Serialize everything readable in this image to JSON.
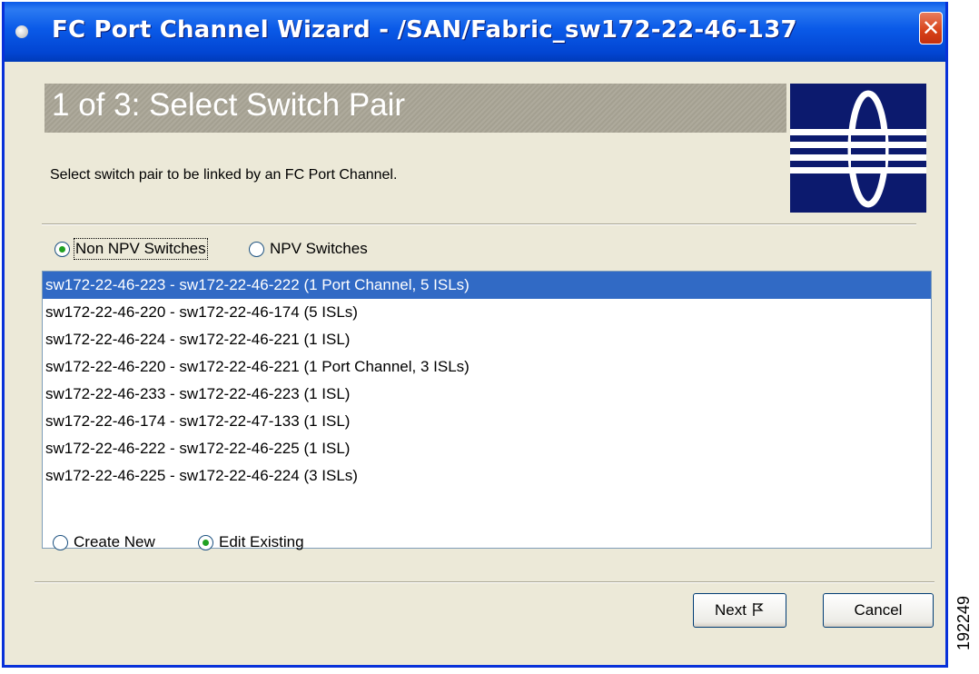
{
  "window": {
    "title": "FC Port Channel Wizard - /SAN/Fabric_sw172-22-46-137",
    "close_label": "✕"
  },
  "wizard": {
    "step_title": "1 of 3: Select Switch Pair",
    "description": "Select switch pair to be linked by an FC Port Channel.",
    "switch_type": {
      "options": [
        "Non NPV Switches",
        "NPV Switches"
      ],
      "selected": "Non NPV Switches"
    },
    "switch_pairs": [
      "sw172-22-46-223 - sw172-22-46-222 (1 Port Channel, 5 ISLs)",
      "sw172-22-46-220 - sw172-22-46-174 (5 ISLs)",
      "sw172-22-46-224 - sw172-22-46-221 (1 ISL)",
      "sw172-22-46-220 - sw172-22-46-221 (1 Port Channel, 3 ISLs)",
      "sw172-22-46-233 - sw172-22-46-223 (1 ISL)",
      "sw172-22-46-174 - sw172-22-47-133 (1 ISL)",
      "sw172-22-46-222 - sw172-22-46-225 (1 ISL)",
      "sw172-22-46-225 - sw172-22-46-224 (3 ISLs)"
    ],
    "selected_pair_index": 0,
    "mode": {
      "options": [
        "Create New",
        "Edit Existing"
      ],
      "selected": "Edit Existing"
    },
    "buttons": {
      "next": "Next",
      "cancel": "Cancel"
    }
  },
  "figure_number": "192249",
  "colors": {
    "titlebar": "#0a5ae8",
    "selection": "#316ac5",
    "logo_background": "#0c1a6e",
    "banner": "#a4a091"
  }
}
